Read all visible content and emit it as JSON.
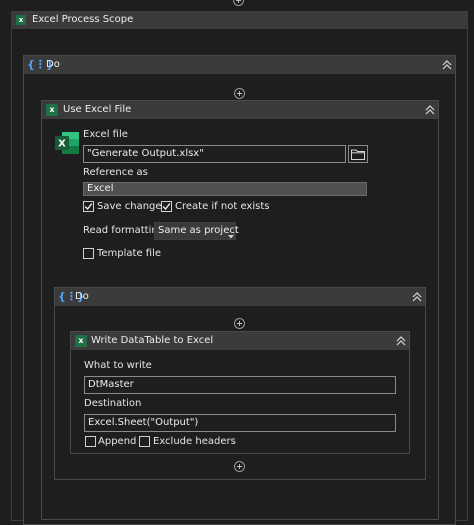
{
  "excel_scope": {
    "title": "Excel Process Scope"
  },
  "outer_do": {
    "title": "Do"
  },
  "use_excel_file": {
    "title": "Use Excel File",
    "excel_file_label": "Excel file",
    "excel_file_value": "\"Generate Output.xlsx\"",
    "reference_as_label": "Reference as",
    "reference_as_value": "Excel",
    "save_changes_label": "Save changes",
    "save_changes_checked": true,
    "create_if_not_exists_label": "Create if not exists",
    "create_if_not_exists_checked": true,
    "read_formatting_label": "Read formatting",
    "read_formatting_value": "Same as project",
    "template_file_label": "Template file",
    "template_file_checked": false
  },
  "inner_do": {
    "title": "Do"
  },
  "write_datatable": {
    "title": "Write DataTable to Excel",
    "what_to_write_label": "What to write",
    "what_to_write_value": "DtMaster",
    "destination_label": "Destination",
    "destination_value": "Excel.Sheet(\"Output\")",
    "append_label": "Append",
    "append_checked": false,
    "exclude_headers_label": "Exclude headers",
    "exclude_headers_checked": false
  },
  "colors": {
    "background": "#1e1e1e",
    "header": "#3b3b3b",
    "border": "#4a4a4a",
    "excel_green": "#1e7145",
    "do_blue": "#4fa3ff"
  }
}
